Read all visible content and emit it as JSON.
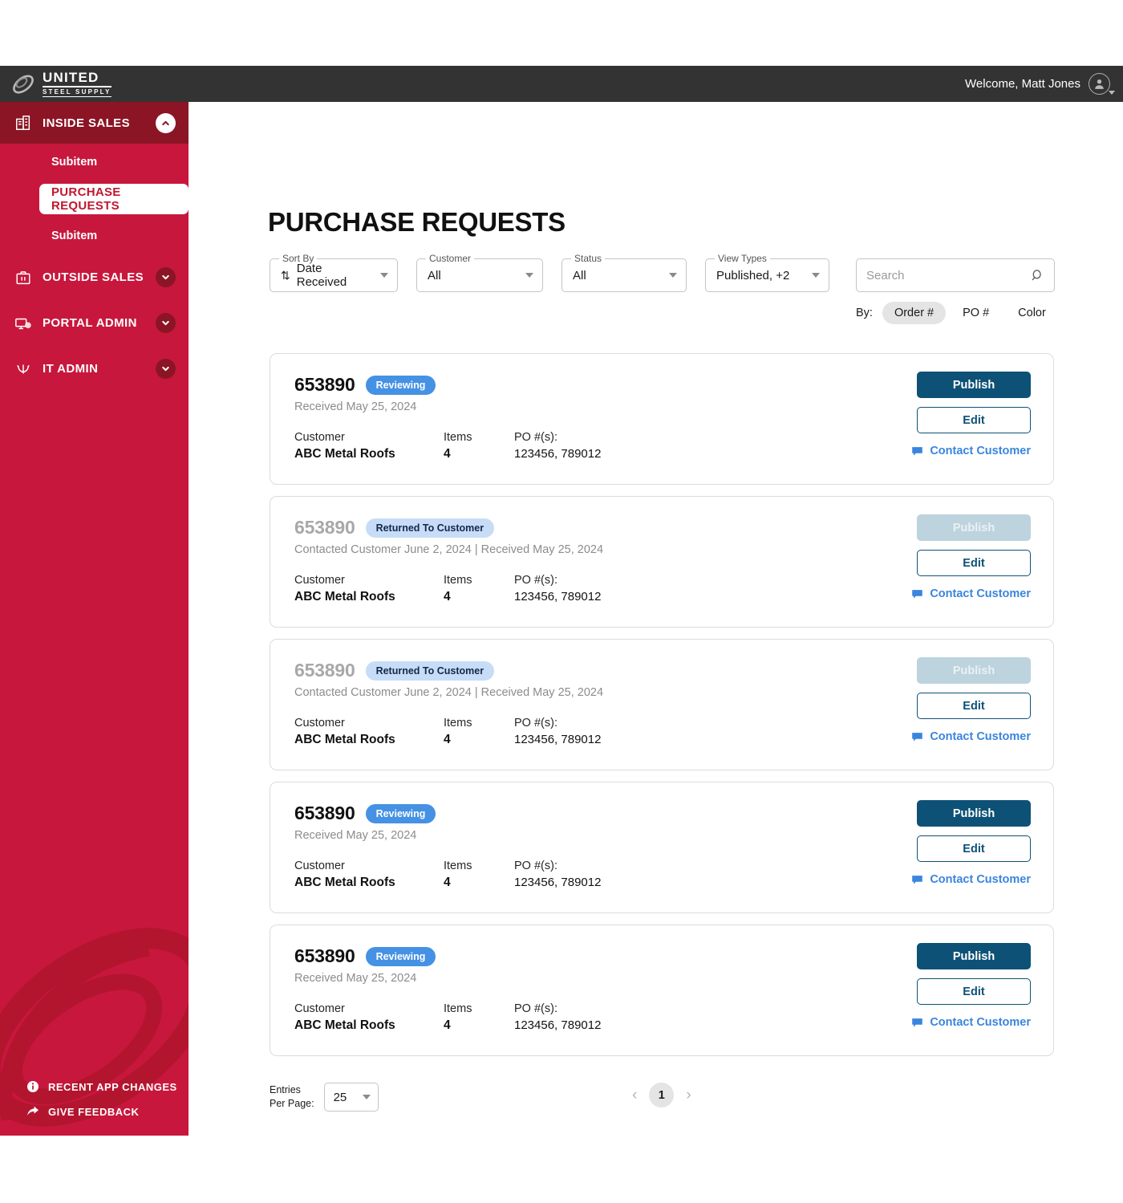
{
  "topbar": {
    "logo_primary": "UNITED",
    "logo_secondary": "STEEL SUPPLY",
    "welcome": "Welcome, Matt Jones"
  },
  "sidebar": {
    "sections": [
      {
        "label": "INSIDE SALES",
        "icon": "building-icon",
        "expanded": true,
        "subitems": [
          {
            "label": "Subitem",
            "active": false
          },
          {
            "label": "PURCHASE REQUESTS",
            "active": true
          },
          {
            "label": "Subitem",
            "active": false
          }
        ]
      },
      {
        "label": "OUTSIDE SALES",
        "icon": "briefcase-icon",
        "expanded": false,
        "subitems": []
      },
      {
        "label": "PORTAL ADMIN",
        "icon": "monitor-gear-icon",
        "expanded": false,
        "subitems": []
      },
      {
        "label": "IT ADMIN",
        "icon": "network-icon",
        "expanded": false,
        "subitems": []
      }
    ],
    "footer_links": [
      {
        "label": "RECENT APP CHANGES",
        "icon": "info-icon"
      },
      {
        "label": "GIVE FEEDBACK",
        "icon": "arrow-share-icon"
      }
    ]
  },
  "main": {
    "title": "PURCHASE REQUESTS",
    "filters": [
      {
        "legend": "Sort By",
        "value": "Date Received",
        "icon": "sort-arrows-icon"
      },
      {
        "legend": "Customer",
        "value": "All",
        "icon": ""
      },
      {
        "legend": "Status",
        "value": "All",
        "icon": ""
      },
      {
        "legend": "View Types",
        "value": "Published, +2",
        "icon": ""
      }
    ],
    "search": {
      "placeholder": "Search",
      "value": ""
    },
    "search_by": {
      "label": "By:",
      "options": [
        {
          "label": "Order #",
          "selected": true
        },
        {
          "label": "PO #",
          "selected": false
        },
        {
          "label": "Color",
          "selected": false
        }
      ]
    },
    "card_labels": {
      "customer": "Customer",
      "items": "Items",
      "po": "PO #(s):",
      "publish": "Publish",
      "edit": "Edit",
      "contact": "Contact Customer"
    },
    "cards": [
      {
        "order_no": "653890",
        "status": "Reviewing",
        "status_kind": "reviewing",
        "date_line": "Received May 25, 2024",
        "customer": "ABC Metal Roofs",
        "items": "4",
        "po_numbers": "123456, 789012",
        "publish_disabled": false
      },
      {
        "order_no": "653890",
        "status": "Returned To Customer",
        "status_kind": "returned",
        "date_line": "Contacted Customer June 2, 2024  |  Received May 25, 2024",
        "customer": "ABC Metal Roofs",
        "items": "4",
        "po_numbers": "123456, 789012",
        "publish_disabled": true
      },
      {
        "order_no": "653890",
        "status": "Returned To Customer",
        "status_kind": "returned",
        "date_line": "Contacted Customer June 2, 2024  |  Received May 25, 2024",
        "customer": "ABC Metal Roofs",
        "items": "4",
        "po_numbers": "123456, 789012",
        "publish_disabled": true
      },
      {
        "order_no": "653890",
        "status": "Reviewing",
        "status_kind": "reviewing",
        "date_line": "Received May 25, 2024",
        "customer": "ABC Metal Roofs",
        "items": "4",
        "po_numbers": "123456, 789012",
        "publish_disabled": false
      },
      {
        "order_no": "653890",
        "status": "Reviewing",
        "status_kind": "reviewing",
        "date_line": "Received May 25, 2024",
        "customer": "ABC Metal Roofs",
        "items": "4",
        "po_numbers": "123456, 789012",
        "publish_disabled": false
      }
    ],
    "pagination": {
      "entries_label_line1": "Entries",
      "entries_label_line2": "Per Page:",
      "entries_value": "25",
      "prev": "‹",
      "next": "›",
      "current_page": "1"
    }
  },
  "colors": {
    "brand_red": "#C8173C",
    "brand_red_dark": "#8B1525",
    "topbar": "#333333",
    "action_blue": "#0E5176",
    "badge_reviewing": "#4591E4",
    "badge_returned": "#C7DCF7",
    "link_blue": "#3A85DD"
  }
}
